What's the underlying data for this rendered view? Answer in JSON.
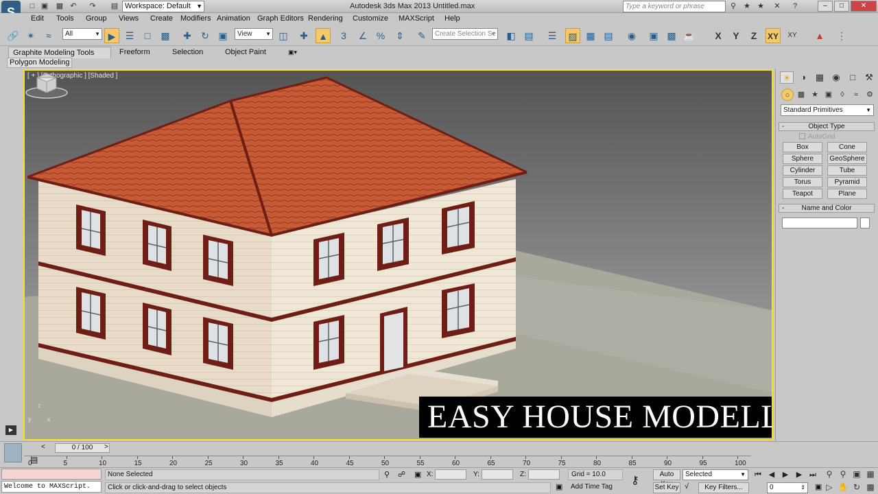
{
  "title_bar": {
    "app_title": "Autodesk 3ds Max  2013      Untitled.max",
    "workspace": "Workspace: Default",
    "search_placeholder": "Type a keyword or phrase",
    "logo": "S"
  },
  "menu": [
    "Edit",
    "Tools",
    "Group",
    "Views",
    "Create",
    "Modifiers",
    "Animation",
    "Graph Editors",
    "Rendering",
    "Customize",
    "MAXScript",
    "Help"
  ],
  "toolbar": {
    "selection_filter": "All",
    "ref_coord": "View",
    "named_selection_placeholder": "Create Selection Se",
    "snap_label": "3",
    "axis_x": "X",
    "axis_y": "Y",
    "axis_z": "Z",
    "axis_xy": "XY"
  },
  "ribbon": {
    "tabs": [
      "Graphite Modeling Tools",
      "Freeform",
      "Selection",
      "Object Paint"
    ],
    "sub_panel": "Polygon Modeling"
  },
  "viewport": {
    "label": "[ + ] [Orthographic ] [Shaded ]",
    "caption": "EASY HOUSE MODELLING",
    "tripod": {
      "x": "x",
      "y": "y",
      "z": "z"
    },
    "colors": {
      "roof": "#c85a35",
      "walls": "#e8dcc8",
      "trim": "#6e1e14",
      "ground": "#a9a89d"
    }
  },
  "command_panel": {
    "category": "Standard Primitives",
    "object_type_title": "Object Type",
    "autogrid": "AutoGrid",
    "primitives": [
      "Box",
      "Cone",
      "Sphere",
      "GeoSphere",
      "Cylinder",
      "Tube",
      "Torus",
      "Pyramid",
      "Teapot",
      "Plane"
    ],
    "name_color_title": "Name and Color",
    "collapse_symbol": "-"
  },
  "timeline": {
    "frame": "0 / 100",
    "prev": "<",
    "next": ">",
    "ticks": [
      "0",
      "5",
      "10",
      "15",
      "20",
      "25",
      "30",
      "35",
      "40",
      "45",
      "50",
      "55",
      "60",
      "65",
      "70",
      "75",
      "80",
      "85",
      "90",
      "95",
      "100"
    ]
  },
  "status": {
    "maxscript_output": "Welcome to MAXScript.",
    "selection": "None Selected",
    "prompt": "Click or click-and-drag to select objects",
    "x_label": "X:",
    "y_label": "Y:",
    "z_label": "Z:",
    "grid": "Grid = 10.0",
    "add_time_tag": "Add Time Tag",
    "auto_key": "Auto Key",
    "set_key": "Set Key",
    "key_mode": "Selected",
    "key_filters": "Key Filters...",
    "current_frame": "0"
  }
}
